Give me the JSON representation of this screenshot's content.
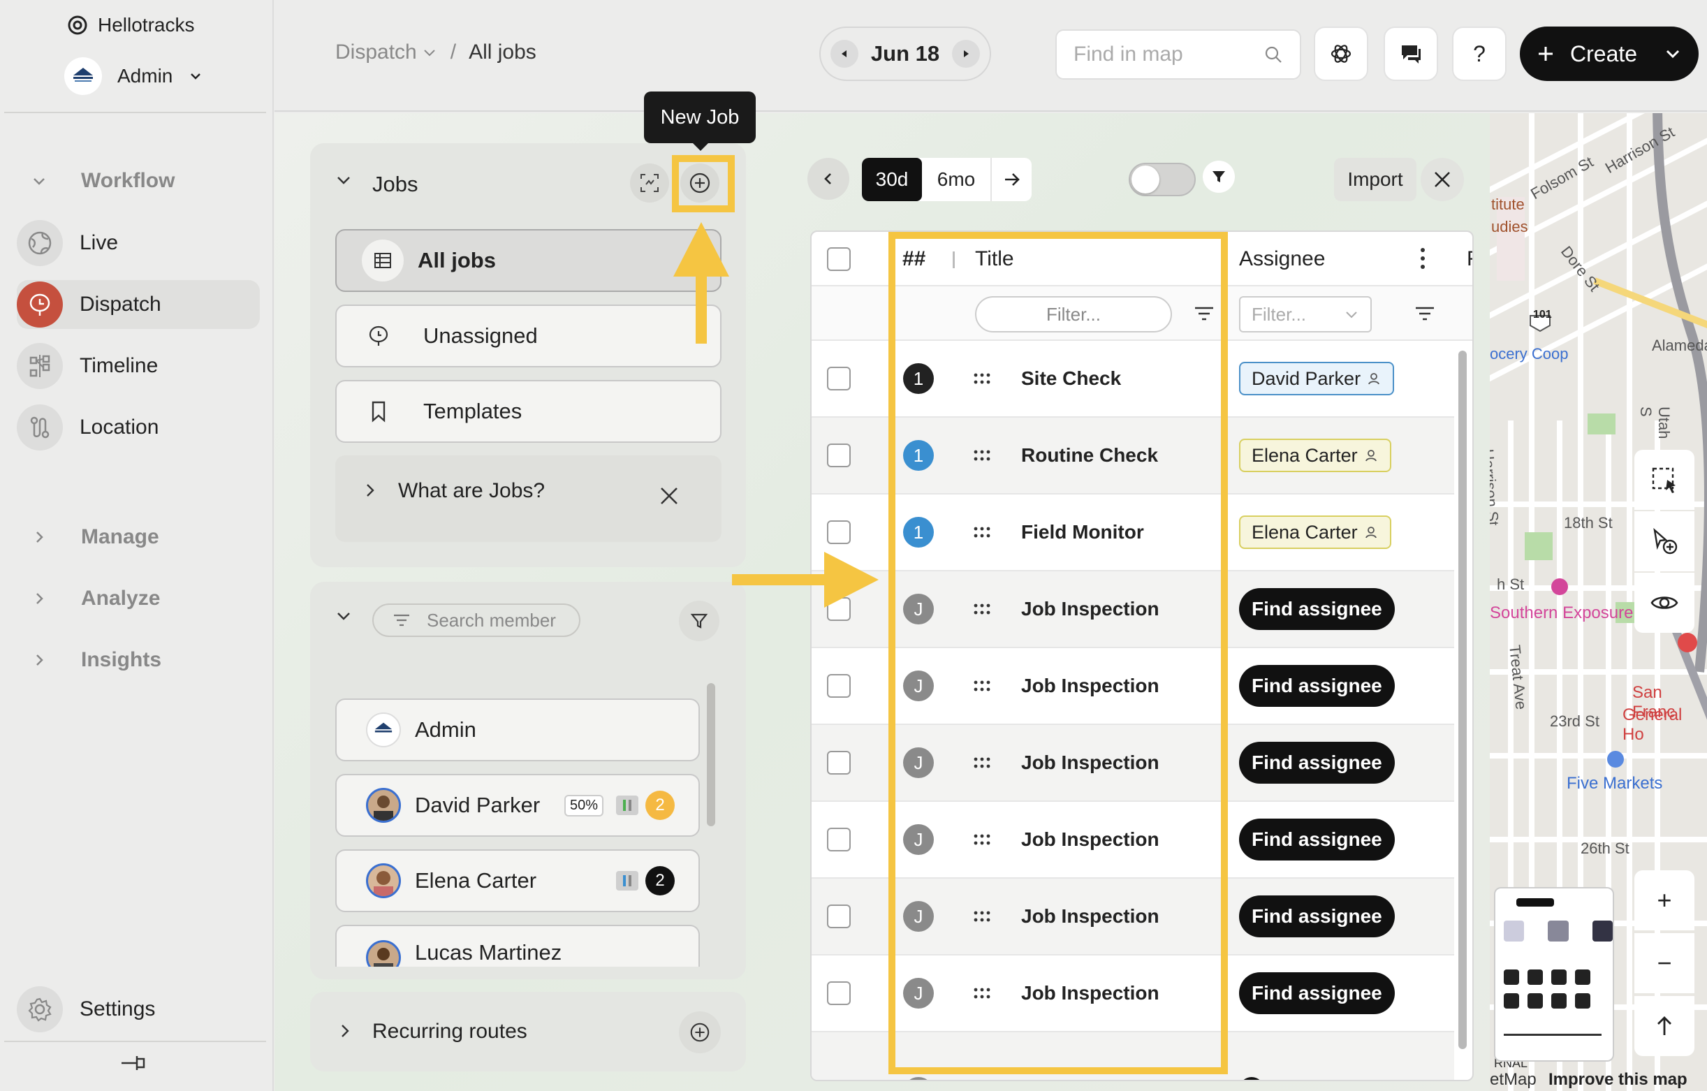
{
  "sidebar": {
    "brand": "Hellotracks",
    "account": "Admin",
    "sections": {
      "workflow": "Workflow",
      "manage": "Manage",
      "analyze": "Analyze",
      "insights": "Insights"
    },
    "nav": {
      "live": "Live",
      "dispatch": "Dispatch",
      "timeline": "Timeline",
      "location": "Location"
    },
    "settings": "Settings"
  },
  "header": {
    "breadcrumb_root": "Dispatch",
    "breadcrumb_sep": "/",
    "breadcrumb_current": "All jobs",
    "date": "Jun 18",
    "search_placeholder": "Find in map",
    "help": "?",
    "create_label": "Create"
  },
  "jobs_panel": {
    "title": "Jobs",
    "tooltip": "New Job",
    "all_jobs": "All jobs",
    "unassigned": "Unassigned",
    "templates": "Templates",
    "what_are_jobs": "What are Jobs?"
  },
  "members_panel": {
    "search_placeholder": "Search member",
    "members": [
      {
        "name": "Admin"
      },
      {
        "name": "David Parker",
        "utilization": "50%",
        "count": "2"
      },
      {
        "name": "Elena Carter",
        "count": "2"
      },
      {
        "name": "Lucas Martinez"
      }
    ]
  },
  "recurring": {
    "title": "Recurring routes"
  },
  "toolbar": {
    "range_30d": "30d",
    "range_6mo": "6mo",
    "import": "Import"
  },
  "table": {
    "col_num": "##",
    "col_title": "Title",
    "col_assignee": "Assignee",
    "col_extra": "F",
    "filter_placeholder": "Filter...",
    "rows": [
      {
        "num": "1",
        "title": "Site Check",
        "assignee": "David Parker"
      },
      {
        "num": "1",
        "title": "Routine Check",
        "assignee": "Elena Carter"
      },
      {
        "num": "1",
        "title": "Field Monitor",
        "assignee": "Elena Carter"
      },
      {
        "num": "J",
        "title": "Job Inspection",
        "assignee": "Find assignee"
      },
      {
        "num": "J",
        "title": "Job Inspection",
        "assignee": "Find assignee"
      },
      {
        "num": "J",
        "title": "Job Inspection",
        "assignee": "Find assignee"
      },
      {
        "num": "J",
        "title": "Job Inspection",
        "assignee": "Find assignee"
      },
      {
        "num": "J",
        "title": "Job Inspection",
        "assignee": "Find assignee"
      },
      {
        "num": "J",
        "title": "Job Inspection",
        "assignee": "Find assignee"
      }
    ]
  },
  "map": {
    "labels": [
      "Folsom St",
      "Harrison St",
      "titute",
      "udies",
      "Dore St",
      "101",
      "ocery Coop",
      "Alameda",
      "Harrison St",
      "Utah S",
      "18th St",
      "h St",
      "Southern Exposure",
      "Treat Ave",
      "San Franc",
      "General Ho",
      "23rd St",
      "Five Markets",
      "26th St",
      "etMap",
      "RNAL",
      "Improve this map"
    ],
    "zoom_in": "+",
    "zoom_out": "−"
  },
  "colors": {
    "accent": "#f5c542",
    "dispatch": "#c5503e",
    "badge_blue": "#3a8fd0",
    "badge_gray": "#8a8a8a"
  }
}
